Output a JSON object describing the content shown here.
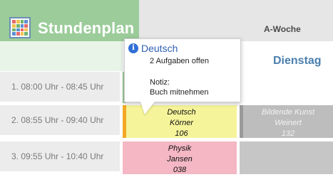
{
  "app": {
    "title": "Stundenplan"
  },
  "header": {
    "week": "A-Woche",
    "day": "Dienstag"
  },
  "time_slots": [
    {
      "label": "1. 08:00 Uhr - 08:45 Uhr"
    },
    {
      "label": "2. 08:55 Uhr - 09:40 Uhr"
    },
    {
      "label": "3. 09:55 Uhr - 10:40 Uhr"
    }
  ],
  "lessons": {
    "deutsch": {
      "subject": "Deutsch",
      "teacher": "Körner",
      "room": "106"
    },
    "physik": {
      "subject": "Physik",
      "teacher": "Jansen",
      "room": "038"
    },
    "kunst": {
      "subject": "Bildende Kunst",
      "teacher": "Weinert",
      "room": "132"
    }
  },
  "popup": {
    "title": "Deutsch",
    "tasks": "2 Aufgaben offen",
    "note_label": "Notiz:",
    "note_text": "Buch mitnehmen"
  },
  "colors": {
    "header_green": "#9ccc9a",
    "deutsch_bg": "#f6f49a",
    "physik_bg": "#f4b7c3",
    "kunst_bg": "#bdbdbd",
    "accent_orange": "#f3a825",
    "day_blue": "#4a7fae"
  },
  "icons": {
    "app": "timetable-grid-icon",
    "info": "info-icon"
  }
}
